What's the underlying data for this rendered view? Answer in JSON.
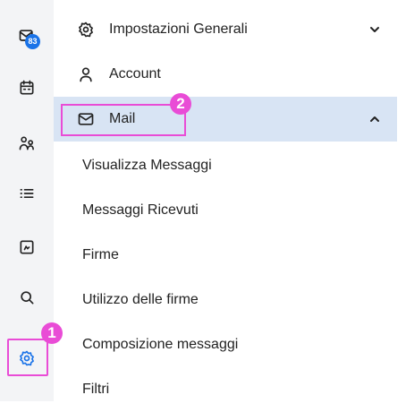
{
  "rail": {
    "items": [
      {
        "icon": "mail-badge-icon",
        "badge": "83"
      },
      {
        "icon": "calendar-icon"
      },
      {
        "icon": "contacts-icon"
      },
      {
        "icon": "list-icon"
      },
      {
        "icon": "folder-icon"
      },
      {
        "icon": "search-icon"
      },
      {
        "icon": "gear-icon"
      }
    ],
    "step_marker": "1"
  },
  "menu": {
    "general_settings": {
      "label": "Impostazioni Generali",
      "icon": "gear-icon",
      "expand_icon": "chevron-down-icon"
    },
    "account": {
      "label": "Account",
      "icon": "user-icon"
    },
    "mail": {
      "label": "Mail",
      "icon": "envelope-icon",
      "collapse_icon": "chevron-up-icon",
      "active": true
    },
    "mail_step_marker": "2",
    "submenu": [
      {
        "label": "Visualizza Messaggi"
      },
      {
        "label": "Messaggi Ricevuti"
      },
      {
        "label": "Firme"
      },
      {
        "label": "Utilizzo delle firme"
      },
      {
        "label": "Composizione messaggi"
      },
      {
        "label": "Filtri"
      }
    ]
  },
  "colors": {
    "accent": "#e94cd6",
    "badge": "#1a73e8",
    "active_row": "#d8e4f4",
    "rail_bg": "#f3f4f6"
  }
}
